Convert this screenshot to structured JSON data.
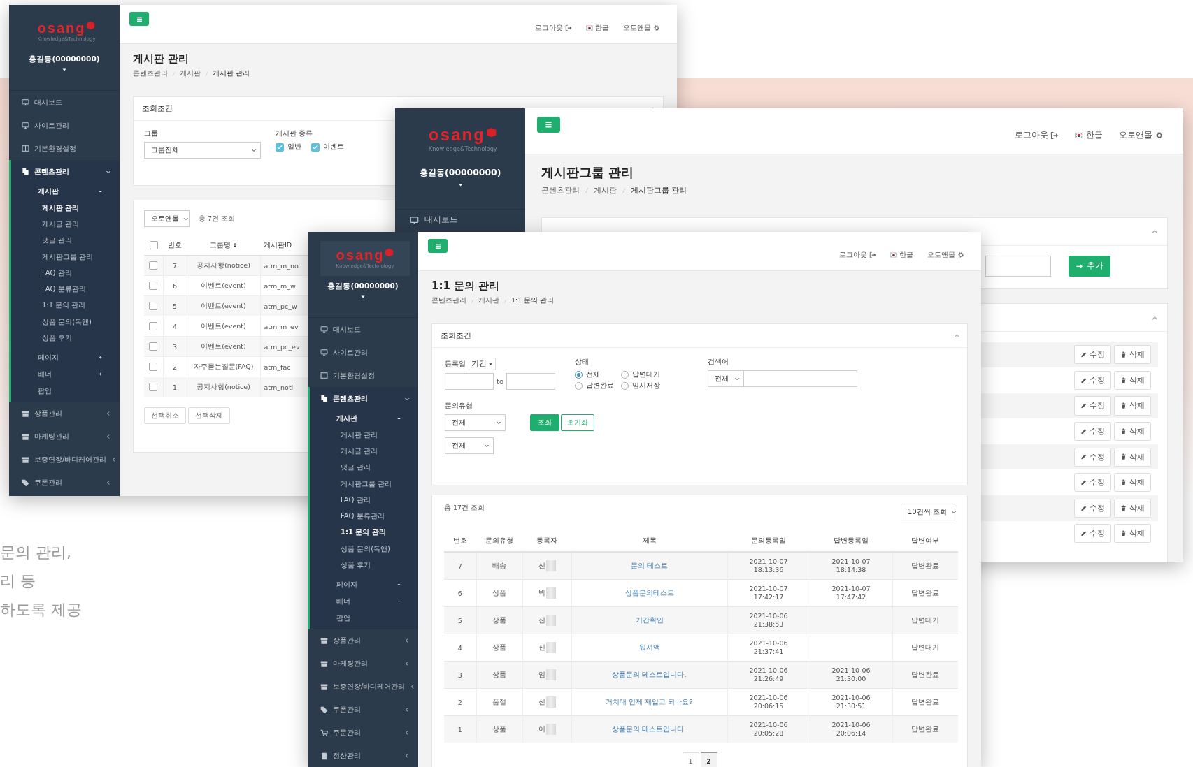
{
  "intro_text": [
    "문의 관리,",
    "리 등",
    "하도록 제공"
  ],
  "board_window": {
    "sidebar": {
      "logo": {
        "wordmark": "osang",
        "tagline": "Knowledge&Technology"
      },
      "user": "홍길동(00000000)",
      "menu": [
        {
          "label": "대시보드",
          "selected": false
        },
        {
          "label": "사이트관리",
          "selected": false
        },
        {
          "label": "기본환경설정",
          "selected": false
        },
        {
          "label": "콘텐츠관리",
          "selected": true,
          "expanded": true,
          "children": [
            {
              "label": "게시판",
              "selected": true,
              "expanded": true,
              "children": [
                {
                  "label": "게시판 관리",
                  "selected": true
                },
                {
                  "label": "게시글 관리",
                  "selected": false
                },
                {
                  "label": "댓글 관리",
                  "selected": false
                },
                {
                  "label": "게시판그룹 관리",
                  "selected": false
                },
                {
                  "label": "FAQ 관리",
                  "selected": false
                },
                {
                  "label": "FAQ 분류관리",
                  "selected": false
                },
                {
                  "label": "1:1 문의 관리",
                  "selected": false
                },
                {
                  "label": "상품 문의(독앤)",
                  "selected": false
                },
                {
                  "label": "상품 후기",
                  "selected": false
                }
              ]
            },
            {
              "label": "페이지",
              "selected": false,
              "expanded": false
            },
            {
              "label": "배너",
              "selected": false,
              "expanded": false
            },
            {
              "label": "팝업",
              "selected": false
            }
          ]
        },
        {
          "label": "상품관리",
          "selected": false,
          "expanded": false
        },
        {
          "label": "마케팅관리",
          "selected": false,
          "expanded": false
        },
        {
          "label": "보증연장/바디케어관리",
          "selected": false,
          "expanded": false
        },
        {
          "label": "쿠폰관리",
          "selected": false,
          "expanded": false
        }
      ]
    },
    "topbar": {
      "links": [
        {
          "kind": "logout",
          "label": "로그아웃"
        },
        {
          "kind": "language",
          "label": "한글"
        },
        {
          "kind": "settings",
          "label": "오토앤몰"
        }
      ]
    },
    "title": "게시판 관리",
    "breadcrumbs": [
      "콘텐츠관리",
      "게시판",
      "게시판 관리"
    ],
    "search_panel": {
      "title": "조회조건",
      "group_label": "그룹",
      "group_select": "그룹전체",
      "type_label": "게시판 종류",
      "types": [
        {
          "label": "일반",
          "checked": true
        },
        {
          "label": "이벤트",
          "checked": true
        }
      ]
    },
    "list_panel": {
      "mall_select": "오토앤몰",
      "count": "총 7건 조회",
      "select_all": false,
      "columns": [
        {
          "label": "번호",
          "sortable": false
        },
        {
          "label": "그룹명",
          "sortable": true
        },
        {
          "label": "게시판ID",
          "sortable": false
        }
      ],
      "rows": [
        {
          "checked": false,
          "no": "7",
          "group": "공지사항(notice)",
          "board_id": "atm_m_no"
        },
        {
          "checked": false,
          "no": "6",
          "group": "이벤트(event)",
          "board_id": "atm_m_w"
        },
        {
          "checked": false,
          "no": "5",
          "group": "이벤트(event)",
          "board_id": "atm_pc_w"
        },
        {
          "checked": false,
          "no": "4",
          "group": "이벤트(event)",
          "board_id": "atm_m_ev"
        },
        {
          "checked": false,
          "no": "3",
          "group": "이벤트(event)",
          "board_id": "atm_pc_ev"
        },
        {
          "checked": false,
          "no": "2",
          "group": "자주묻는질문(FAQ)",
          "board_id": "atm_fac"
        },
        {
          "checked": false,
          "no": "1",
          "group": "공지사항(notice)",
          "board_id": "atm_noti"
        }
      ],
      "buttons": [
        "선택취소",
        "선택삭제"
      ]
    }
  },
  "group_window": {
    "sidebar": {
      "logo": {
        "wordmark": "osang",
        "tagline": "Knowledge&Technology"
      },
      "user": "홍길동(00000000)",
      "menu": [
        {
          "label": "대시보드",
          "selected": false
        }
      ]
    },
    "topbar": {
      "links": [
        {
          "kind": "logout",
          "label": "로그아웃"
        },
        {
          "kind": "language",
          "label": "한글"
        },
        {
          "kind": "settings",
          "label": "오토앤몰"
        }
      ]
    },
    "title": "게시판그룹 관리",
    "breadcrumbs": [
      "콘텐츠관리",
      "게시판",
      "게시판그룹 관리"
    ],
    "search_panel": {
      "add_button": "추가"
    },
    "list_panel": {
      "rows": [
        {
          "edit": "수정",
          "delete": "삭제"
        },
        {
          "edit": "수정",
          "delete": "삭제"
        },
        {
          "edit": "수정",
          "delete": "삭제"
        },
        {
          "edit": "수정",
          "delete": "삭제"
        },
        {
          "edit": "수정",
          "delete": "삭제"
        },
        {
          "edit": "수정",
          "delete": "삭제"
        },
        {
          "edit": "수정",
          "delete": "삭제"
        },
        {
          "edit": "수정",
          "delete": "삭제"
        }
      ]
    }
  },
  "inquiry_window": {
    "sidebar": {
      "logo": {
        "wordmark": "osang",
        "tagline": "Knowledge&Technology"
      },
      "user": "홍길동(00000000)",
      "menu": [
        {
          "label": "대시보드",
          "selected": false
        },
        {
          "label": "사이트관리",
          "selected": false
        },
        {
          "label": "기본환경설정",
          "selected": false
        },
        {
          "label": "콘텐츠관리",
          "selected": true,
          "expanded": true,
          "children": [
            {
              "label": "게시판",
              "selected": true,
              "expanded": true,
              "children": [
                {
                  "label": "게시판 관리",
                  "selected": false
                },
                {
                  "label": "게시글 관리",
                  "selected": false
                },
                {
                  "label": "댓글 관리",
                  "selected": false
                },
                {
                  "label": "게시판그룹 관리",
                  "selected": false
                },
                {
                  "label": "FAQ 관리",
                  "selected": false
                },
                {
                  "label": "FAQ 분류관리",
                  "selected": false
                },
                {
                  "label": "1:1 문의 관리",
                  "selected": true
                },
                {
                  "label": "상품 문의(독앤)",
                  "selected": false
                },
                {
                  "label": "상품 후기",
                  "selected": false
                }
              ]
            },
            {
              "label": "페이지",
              "selected": false,
              "expanded": false
            },
            {
              "label": "배너",
              "selected": false,
              "expanded": false
            },
            {
              "label": "팝업",
              "selected": false
            }
          ]
        },
        {
          "label": "상품관리",
          "selected": false,
          "expanded": false
        },
        {
          "label": "마케팅관리",
          "selected": false,
          "expanded": false
        },
        {
          "label": "보증연장/바디케어관리",
          "selected": false,
          "expanded": false
        },
        {
          "label": "쿠폰관리",
          "selected": false,
          "expanded": false
        },
        {
          "label": "주문관리",
          "selected": false,
          "expanded": false
        },
        {
          "label": "정산관리",
          "selected": false,
          "expanded": false
        }
      ]
    },
    "topbar": {
      "links": [
        {
          "kind": "logout",
          "label": "로그아웃"
        },
        {
          "kind": "language",
          "label": "한글"
        },
        {
          "kind": "settings",
          "label": "오토앤몰"
        }
      ]
    },
    "title": "1:1 문의 관리",
    "breadcrumbs": [
      "콘텐츠관리",
      "게시판",
      "1:1 문의 관리"
    ],
    "search_panel": {
      "title": "조회조건",
      "date_label": "등록일",
      "date_mode": "기간",
      "range_separator": "to",
      "status_label": "상태",
      "statuses": [
        {
          "label": "전체",
          "selected": true
        },
        {
          "label": "답변대기",
          "selected": false
        },
        {
          "label": "답변완료",
          "selected": false
        },
        {
          "label": "임시저장",
          "selected": false
        }
      ],
      "keyword_label": "검색어",
      "keyword_select": "전체",
      "type_label": "문의유형",
      "type_select": "전체",
      "search_button": "조회",
      "reset_button": "초기화",
      "extra_select": "전체"
    },
    "list_panel": {
      "count": "총 17건 조회",
      "page_size": "10건씩 조회",
      "columns": [
        "번호",
        "문의유형",
        "등록자",
        "제목",
        "문의등록일",
        "답변등록일",
        "답변여부"
      ],
      "rows": [
        {
          "no": "7",
          "type": "배송",
          "registrant": "신",
          "title": "문의 테스트",
          "inquiry_date": "2021-10-07\n18:13:36",
          "answer_date": "2021-10-07\n18:14:38",
          "status": "답변완료"
        },
        {
          "no": "6",
          "type": "상품",
          "registrant": "박",
          "title": "상품문의테스트",
          "inquiry_date": "2021-10-07\n17:42:17",
          "answer_date": "2021-10-07\n17:47:42",
          "status": "답변완료"
        },
        {
          "no": "5",
          "type": "상품",
          "registrant": "신",
          "title": "기간확인",
          "inquiry_date": "2021-10-06\n21:38:53",
          "status": "답변대기"
        },
        {
          "no": "4",
          "type": "상품",
          "registrant": "신",
          "title": "워셔액",
          "inquiry_date": "2021-10-06\n21:37:41",
          "status": "답변대기"
        },
        {
          "no": "3",
          "type": "상품",
          "registrant": "임",
          "title": "상품문의 테스트입니다.",
          "inquiry_date": "2021-10-06\n21:26:49",
          "answer_date": "2021-10-06\n21:30:00",
          "status": "답변완료"
        },
        {
          "no": "2",
          "type": "품절",
          "registrant": "신",
          "title": "거치대 언제 재입고 되나요?",
          "inquiry_date": "2021-10-06\n20:06:15",
          "answer_date": "2021-10-06\n21:30:51",
          "status": "답변완료"
        },
        {
          "no": "1",
          "type": "상품",
          "registrant": "이",
          "title": "상품문의 테스트입니다.",
          "inquiry_date": "2021-10-06\n20:05:28",
          "answer_date": "2021-10-06\n20:06:14",
          "status": "답변완료"
        }
      ],
      "pages": [
        {
          "label": "1",
          "selected": false
        },
        {
          "label": "2",
          "selected": true
        }
      ]
    }
  }
}
